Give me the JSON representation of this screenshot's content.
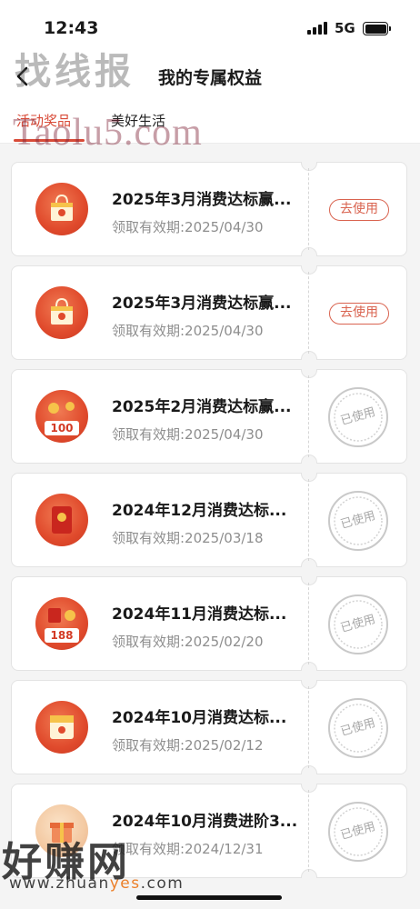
{
  "status": {
    "time": "12:43",
    "network": "5G"
  },
  "header": {
    "title": "我的专属权益",
    "back_icon": "chevron-left-icon"
  },
  "tabs": [
    {
      "label": "活动奖品",
      "active": true
    },
    {
      "label": "美好生活",
      "active": false
    }
  ],
  "colors": {
    "accent": "#d84a37",
    "used_gray": "#a8a8a8",
    "date_gray": "#8e8e8e"
  },
  "cards": [
    {
      "title": "2025年3月消费达标赢...",
      "date": "领取有效期:2025/04/30",
      "action": "去使用",
      "status": "available",
      "icon": "gift-bag-icon"
    },
    {
      "title": "2025年3月消费达标赢...",
      "date": "领取有效期:2025/04/30",
      "action": "去使用",
      "status": "available",
      "icon": "gift-bag-icon"
    },
    {
      "title": "2025年2月消费达标赢...",
      "date": "领取有效期:2025/04/30",
      "action": "已使用",
      "status": "used",
      "icon": "coupon-100-icon",
      "badge": "100"
    },
    {
      "title": "2024年12月消费达标...",
      "date": "领取有效期:2025/03/18",
      "action": "已使用",
      "status": "used",
      "icon": "red-envelope-icon"
    },
    {
      "title": "2024年11月消费达标...",
      "date": "领取有效期:2025/02/20",
      "action": "已使用",
      "status": "used",
      "icon": "coupon-188-icon",
      "badge": "188"
    },
    {
      "title": "2024年10月消费达标...",
      "date": "领取有效期:2025/02/12",
      "action": "已使用",
      "status": "used",
      "icon": "red-envelope-icon"
    },
    {
      "title": "2024年10月消费进阶3...",
      "date": "领取有效期:2024/12/31",
      "action": "已使用",
      "status": "used",
      "icon": "gift-box-icon"
    }
  ],
  "watermarks": {
    "top": "找线报",
    "middle": "Taolu5.com",
    "bottom": "好赚网",
    "url_prefix": "www.zhuan",
    "url_highlight": "yes",
    "url_suffix": ".com"
  }
}
